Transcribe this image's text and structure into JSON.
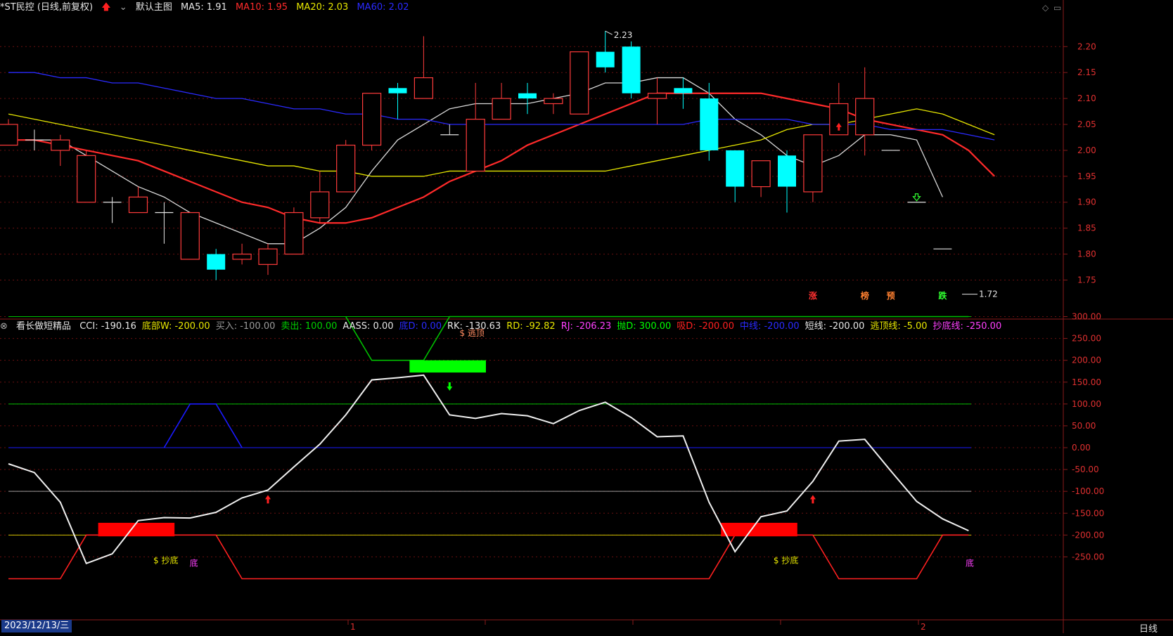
{
  "main_header": {
    "title": "*ST民控 (日线,前复权)",
    "template": "默认主图",
    "ma5": "MA5: 1.91",
    "ma10": "MA10: 1.95",
    "ma20": "MA20: 2.03",
    "ma60": "MA60: 2.02"
  },
  "indicator_header": {
    "name": "看长做短精品",
    "items": [
      {
        "text": "CCI: -190.16",
        "color": "#e6e6e6"
      },
      {
        "text": "底部W: -200.00",
        "color": "#e6e600"
      },
      {
        "text": "买入: -100.00",
        "color": "#9a9a9a"
      },
      {
        "text": "卖出: 100.00",
        "color": "#00d000"
      },
      {
        "text": "AASS: 0.00",
        "color": "#e6e6e6"
      },
      {
        "text": "底D: 0.00",
        "color": "#2a2aff"
      },
      {
        "text": "RK: -130.63",
        "color": "#e6e6e6"
      },
      {
        "text": "RD: -92.82",
        "color": "#e6e600"
      },
      {
        "text": "RJ: -206.23",
        "color": "#ff40ff"
      },
      {
        "text": "抛D: 300.00",
        "color": "#00ff00"
      },
      {
        "text": "吸D: -200.00",
        "color": "#ff2020"
      },
      {
        "text": "中线: -200.00",
        "color": "#2a2aff"
      },
      {
        "text": "短线: -200.00",
        "color": "#e6e6e6"
      },
      {
        "text": "逃顶线: -5.00",
        "color": "#e6e600"
      },
      {
        "text": "抄底线: -250.00",
        "color": "#ff40ff"
      }
    ]
  },
  "footer": {
    "date": "2023/12/13/三",
    "period": "日线",
    "month_marks": [
      "1",
      "2"
    ]
  },
  "chart_data": [
    {
      "type": "candlestick",
      "title": "*ST民控 (日线,前复权)",
      "ylim": [
        1.71,
        2.26
      ],
      "y_ticks": [
        1.75,
        1.8,
        1.85,
        1.9,
        1.95,
        2.0,
        2.05,
        2.1,
        2.15,
        2.2
      ],
      "candles": [
        {
          "o": 2.01,
          "c": 2.05,
          "h": 2.06,
          "l": 2.01
        },
        {
          "o": 2.02,
          "c": 2.02,
          "h": 2.04,
          "l": 2.0
        },
        {
          "o": 2.0,
          "c": 2.02,
          "h": 2.03,
          "l": 1.97
        },
        {
          "o": 1.9,
          "c": 1.99,
          "h": 2.0,
          "l": 1.9
        },
        {
          "o": 1.9,
          "c": 1.9,
          "h": 1.91,
          "l": 1.86
        },
        {
          "o": 1.88,
          "c": 1.91,
          "h": 1.93,
          "l": 1.88
        },
        {
          "o": 1.88,
          "c": 1.88,
          "h": 1.9,
          "l": 1.82
        },
        {
          "o": 1.79,
          "c": 1.88,
          "h": 1.88,
          "l": 1.79
        },
        {
          "o": 1.8,
          "c": 1.77,
          "h": 1.81,
          "l": 1.75
        },
        {
          "o": 1.79,
          "c": 1.8,
          "h": 1.82,
          "l": 1.78
        },
        {
          "o": 1.78,
          "c": 1.81,
          "h": 1.82,
          "l": 1.76
        },
        {
          "o": 1.8,
          "c": 1.88,
          "h": 1.89,
          "l": 1.8
        },
        {
          "o": 1.87,
          "c": 1.92,
          "h": 1.96,
          "l": 1.86
        },
        {
          "o": 1.92,
          "c": 2.01,
          "h": 2.02,
          "l": 1.92
        },
        {
          "o": 2.01,
          "c": 2.11,
          "h": 2.11,
          "l": 2.0
        },
        {
          "o": 2.12,
          "c": 2.11,
          "h": 2.13,
          "l": 2.06
        },
        {
          "o": 2.1,
          "c": 2.14,
          "h": 2.22,
          "l": 2.1
        },
        {
          "o": 2.03,
          "c": 2.03,
          "h": 2.05,
          "l": 2.03
        },
        {
          "o": 1.96,
          "c": 2.06,
          "h": 2.13,
          "l": 1.96
        },
        {
          "o": 2.06,
          "c": 2.1,
          "h": 2.13,
          "l": 2.06
        },
        {
          "o": 2.11,
          "c": 2.1,
          "h": 2.13,
          "l": 2.07
        },
        {
          "o": 2.09,
          "c": 2.1,
          "h": 2.11,
          "l": 2.07
        },
        {
          "o": 2.07,
          "c": 2.19,
          "h": 2.19,
          "l": 2.07
        },
        {
          "o": 2.19,
          "c": 2.16,
          "h": 2.23,
          "l": 2.15
        },
        {
          "o": 2.2,
          "c": 2.11,
          "h": 2.21,
          "l": 2.1
        },
        {
          "o": 2.1,
          "c": 2.11,
          "h": 2.14,
          "l": 2.05
        },
        {
          "o": 2.12,
          "c": 2.11,
          "h": 2.14,
          "l": 2.08
        },
        {
          "o": 2.1,
          "c": 2.0,
          "h": 2.13,
          "l": 1.98
        },
        {
          "o": 2.0,
          "c": 1.93,
          "h": 2.0,
          "l": 1.9
        },
        {
          "o": 1.93,
          "c": 1.98,
          "h": 1.98,
          "l": 1.91
        },
        {
          "o": 1.99,
          "c": 1.93,
          "h": 2.0,
          "l": 1.88
        },
        {
          "o": 1.92,
          "c": 2.03,
          "h": 2.03,
          "l": 1.9
        },
        {
          "o": 2.03,
          "c": 2.09,
          "h": 2.13,
          "l": 2.03
        },
        {
          "o": 2.03,
          "c": 2.1,
          "h": 2.16,
          "l": 1.99
        },
        {
          "o": 2.0,
          "c": 2.0,
          "h": 2.0,
          "l": 2.0
        },
        {
          "o": 1.9,
          "c": 1.9,
          "h": 1.9,
          "l": 1.9
        },
        {
          "o": 1.81,
          "c": 1.81,
          "h": 1.81,
          "l": 1.81
        }
      ],
      "series": [
        {
          "name": "MA5",
          "color": "#d8d8d8",
          "values": [
            2.02,
            2.02,
            2.02,
            1.99,
            1.96,
            1.93,
            1.91,
            1.88,
            1.86,
            1.84,
            1.82,
            1.82,
            1.85,
            1.89,
            1.96,
            2.02,
            2.05,
            2.08,
            2.09,
            2.09,
            2.09,
            2.1,
            2.11,
            2.13,
            2.13,
            2.14,
            2.14,
            2.11,
            2.06,
            2.03,
            1.99,
            1.97,
            1.99,
            2.03,
            2.03,
            2.02,
            1.91
          ]
        },
        {
          "name": "MA10",
          "color": "#ff2a2a",
          "values": [
            2.02,
            2.02,
            2.01,
            2.0,
            1.99,
            1.98,
            1.96,
            1.94,
            1.92,
            1.9,
            1.89,
            1.87,
            1.86,
            1.86,
            1.87,
            1.89,
            1.91,
            1.94,
            1.96,
            1.98,
            2.01,
            2.03,
            2.05,
            2.07,
            2.09,
            2.11,
            2.11,
            2.11,
            2.11,
            2.11,
            2.1,
            2.09,
            2.08,
            2.06,
            2.05,
            2.04,
            2.03,
            2.0,
            1.95
          ]
        },
        {
          "name": "MA20",
          "color": "#e6e600",
          "values": [
            2.07,
            2.06,
            2.05,
            2.04,
            2.03,
            2.02,
            2.01,
            2.0,
            1.99,
            1.98,
            1.97,
            1.97,
            1.96,
            1.96,
            1.95,
            1.95,
            1.95,
            1.96,
            1.96,
            1.96,
            1.96,
            1.96,
            1.96,
            1.96,
            1.97,
            1.98,
            1.99,
            2.0,
            2.01,
            2.02,
            2.04,
            2.05,
            2.05,
            2.06,
            2.07,
            2.08,
            2.07,
            2.05,
            2.03
          ]
        },
        {
          "name": "MA60",
          "color": "#2a2aff",
          "values": [
            2.15,
            2.15,
            2.14,
            2.14,
            2.13,
            2.13,
            2.12,
            2.11,
            2.1,
            2.1,
            2.09,
            2.08,
            2.08,
            2.07,
            2.07,
            2.06,
            2.06,
            2.05,
            2.05,
            2.05,
            2.05,
            2.05,
            2.05,
            2.05,
            2.05,
            2.05,
            2.05,
            2.06,
            2.06,
            2.06,
            2.06,
            2.05,
            2.05,
            2.05,
            2.04,
            2.04,
            2.04,
            2.03,
            2.02
          ]
        }
      ],
      "annotations": {
        "high_label": "2.23",
        "low_label": "1.72",
        "bottom_tags": [
          {
            "text": "涨",
            "color": "#ff3030",
            "index": 31
          },
          {
            "text": "榜",
            "color": "#ff8030",
            "index": 33
          },
          {
            "text": "预",
            "color": "#ff8030",
            "index": 34
          },
          {
            "text": "跌",
            "color": "#30ff30",
            "index": 36
          }
        ],
        "up_arrow_index": 32,
        "down_arrow_index": 35
      }
    },
    {
      "type": "line",
      "title": "看长做短精品",
      "ylim": [
        -290,
        325
      ],
      "y_ticks": [
        300,
        250,
        200,
        150,
        100,
        50,
        0,
        -50,
        -100,
        -150,
        -200,
        -250
      ],
      "hlines": [
        {
          "value": 300,
          "color": "#00c000"
        },
        {
          "value": 100,
          "color": "#00c000"
        },
        {
          "value": 0,
          "color": "#1a1aff"
        },
        {
          "value": -100,
          "color": "#9a9a9a"
        },
        {
          "value": -200,
          "color": "#d0c000"
        }
      ],
      "cci": [
        -37,
        -57,
        -125,
        -265,
        -243,
        -167,
        -160,
        -161,
        -148,
        -115,
        -97,
        -44,
        8,
        75,
        155,
        160,
        166,
        75,
        67,
        78,
        73,
        55,
        85,
        104,
        69,
        25,
        27,
        -125,
        -238,
        -158,
        -145,
        -77,
        15,
        19,
        -53,
        -123,
        -163,
        -190
      ],
      "polylines": [
        {
          "name": "抛D",
          "color": "#00c000",
          "points": [
            [
              13,
              300
            ],
            [
              14,
              200
            ],
            [
              16,
              200
            ],
            [
              17,
              300
            ],
            [
              37,
              300
            ]
          ]
        },
        {
          "name": "底D",
          "color": "#1a1aff",
          "points": [
            [
              6,
              0
            ],
            [
              7,
              100
            ],
            [
              8,
              100
            ],
            [
              9,
              0
            ]
          ]
        },
        {
          "name": "吸D",
          "color": "#ff2020",
          "points": [
            [
              0,
              -300
            ],
            [
              2,
              -300
            ],
            [
              3,
              -200
            ],
            [
              8,
              -200
            ],
            [
              9,
              -300
            ],
            [
              27,
              -300
            ],
            [
              28,
              -200
            ],
            [
              31,
              -200
            ],
            [
              32,
              -300
            ],
            [
              35,
              -300
            ],
            [
              36,
              -200
            ],
            [
              37,
              -200
            ]
          ]
        }
      ],
      "blocks": [
        {
          "color": "#00ff00",
          "x0": 16,
          "x1": 18.4,
          "y0": 200,
          "y1": 172
        },
        {
          "color": "#ff0000",
          "x0": 4,
          "x1": 6.4,
          "y0": -172,
          "y1": -203
        },
        {
          "color": "#ff0000",
          "x0": 28,
          "x1": 30.4,
          "y0": -172,
          "y1": -203
        }
      ],
      "labels": [
        {
          "text": "$ 逃顶",
          "color": "#ff8a60",
          "x": 17.6,
          "y": 262
        },
        {
          "text": "$ 抄底",
          "color": "#e6e600",
          "x": 5.8,
          "y": -258
        },
        {
          "text": "$ 抄底",
          "color": "#e6e600",
          "x": 29.7,
          "y": -258
        },
        {
          "text": "底",
          "color": "#ff40ff",
          "x": 7.2,
          "y": -265
        },
        {
          "text": "底",
          "color": "#ff40ff",
          "x": 37.1,
          "y": -265
        }
      ],
      "arrows": [
        {
          "dir": "down",
          "color": "#00ff00",
          "x": 17,
          "y": 140
        },
        {
          "dir": "up",
          "color": "#ff2020",
          "x": 10,
          "y": -118
        },
        {
          "dir": "up",
          "color": "#ff2020",
          "x": 31,
          "y": -118
        }
      ]
    }
  ]
}
